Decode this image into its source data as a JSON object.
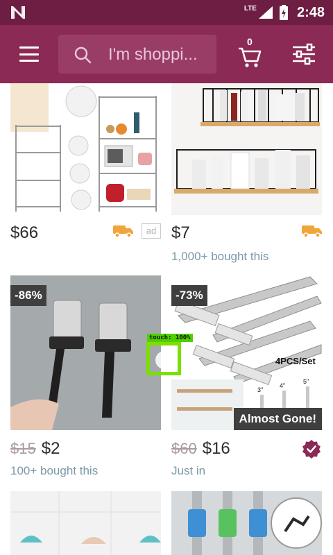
{
  "status_bar": {
    "network": "LTE",
    "time": "2:48",
    "colors": {
      "background": "#6d1e42"
    }
  },
  "app_bar": {
    "search_placeholder": "I'm shoppi...",
    "cart_count": "0",
    "colors": {
      "background": "#8a2a55",
      "search_background": "#9a3d66"
    },
    "icons": {
      "menu": "hamburger-menu-icon",
      "search": "search-icon",
      "cart": "cart-icon",
      "filter": "filter-sliders-icon"
    }
  },
  "products": [
    {
      "price": "$66",
      "subtitle": "",
      "shipping_icon": "truck-icon",
      "ad_label": "ad",
      "image": "wire-kitchen-shelf-rack"
    },
    {
      "price": "$7",
      "subtitle": "1,000+ bought this",
      "shipping_icon": "truck-icon",
      "image": "wall-mounted-wire-shelves"
    },
    {
      "discount": "-86%",
      "old_price": "$15",
      "price": "$2",
      "subtitle": "100+ bought this",
      "image": "razor-wall-holders"
    },
    {
      "discount": "-73%",
      "old_price": "$60",
      "price": "$16",
      "subtitle": "Just in",
      "tag": "Almost Gone!",
      "image_text": "4PCS/Set",
      "size_labels": [
        "3\"",
        "4\"",
        "5\""
      ],
      "status_icon": "verified-check-icon",
      "image": "floating-shelf-brackets"
    },
    {
      "image": "wall-hooks-umbrella"
    },
    {
      "image": "foam-roller-bars"
    }
  ],
  "touch_indicator": {
    "label": "touch: 100%",
    "color": "#7be000"
  }
}
